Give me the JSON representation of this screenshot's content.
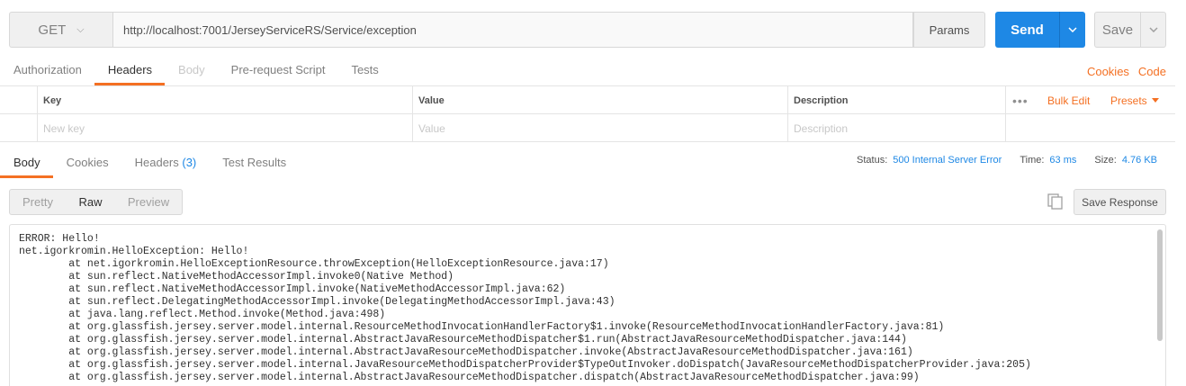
{
  "request": {
    "method": "GET",
    "url": "http://localhost:7001/JerseyServiceRS/Service/exception",
    "params_label": "Params",
    "send_label": "Send",
    "save_label": "Save"
  },
  "request_tabs": [
    {
      "label": "Authorization",
      "state": "normal"
    },
    {
      "label": "Headers",
      "state": "active"
    },
    {
      "label": "Body",
      "state": "disabled"
    },
    {
      "label": "Pre-request Script",
      "state": "normal"
    },
    {
      "label": "Tests",
      "state": "normal"
    }
  ],
  "request_links": {
    "cookies": "Cookies",
    "code": "Code"
  },
  "headers_table": {
    "columns": {
      "key": "Key",
      "value": "Value",
      "description": "Description"
    },
    "placeholders": {
      "key": "New key",
      "value": "Value",
      "description": "Description"
    },
    "bulk_edit": "Bulk Edit",
    "presets": "Presets"
  },
  "response_tabs": {
    "body": "Body",
    "cookies": "Cookies",
    "headers": "Headers",
    "headers_count": "(3)",
    "test_results": "Test Results"
  },
  "response_meta": {
    "status_label": "Status:",
    "status_value": "500 Internal Server Error",
    "time_label": "Time:",
    "time_value": "63 ms",
    "size_label": "Size:",
    "size_value": "4.76 KB"
  },
  "view_modes": {
    "pretty": "Pretty",
    "raw": "Raw",
    "preview": "Preview",
    "active": "Raw"
  },
  "save_response_label": "Save Response",
  "response_body": [
    "ERROR: Hello!",
    "net.igorkromin.HelloException: Hello!",
    "\tat net.igorkromin.HelloExceptionResource.throwException(HelloExceptionResource.java:17)",
    "\tat sun.reflect.NativeMethodAccessorImpl.invoke0(Native Method)",
    "\tat sun.reflect.NativeMethodAccessorImpl.invoke(NativeMethodAccessorImpl.java:62)",
    "\tat sun.reflect.DelegatingMethodAccessorImpl.invoke(DelegatingMethodAccessorImpl.java:43)",
    "\tat java.lang.reflect.Method.invoke(Method.java:498)",
    "\tat org.glassfish.jersey.server.model.internal.ResourceMethodInvocationHandlerFactory$1.invoke(ResourceMethodInvocationHandlerFactory.java:81)",
    "\tat org.glassfish.jersey.server.model.internal.AbstractJavaResourceMethodDispatcher$1.run(AbstractJavaResourceMethodDispatcher.java:144)",
    "\tat org.glassfish.jersey.server.model.internal.AbstractJavaResourceMethodDispatcher.invoke(AbstractJavaResourceMethodDispatcher.java:161)",
    "\tat org.glassfish.jersey.server.model.internal.JavaResourceMethodDispatcherProvider$TypeOutInvoker.doDispatch(JavaResourceMethodDispatcherProvider.java:205)",
    "\tat org.glassfish.jersey.server.model.internal.AbstractJavaResourceMethodDispatcher.dispatch(AbstractJavaResourceMethodDispatcher.java:99)"
  ],
  "colors": {
    "accent": "#f47023",
    "primary": "#1e88e5"
  },
  "icons": {
    "method_dropdown": "chevron-down-icon",
    "send_dropdown": "chevron-down-icon",
    "save_dropdown": "chevron-down-icon",
    "copy": "copy-icon",
    "more": "more-dots-icon",
    "presets_caret": "caret-down-icon"
  }
}
